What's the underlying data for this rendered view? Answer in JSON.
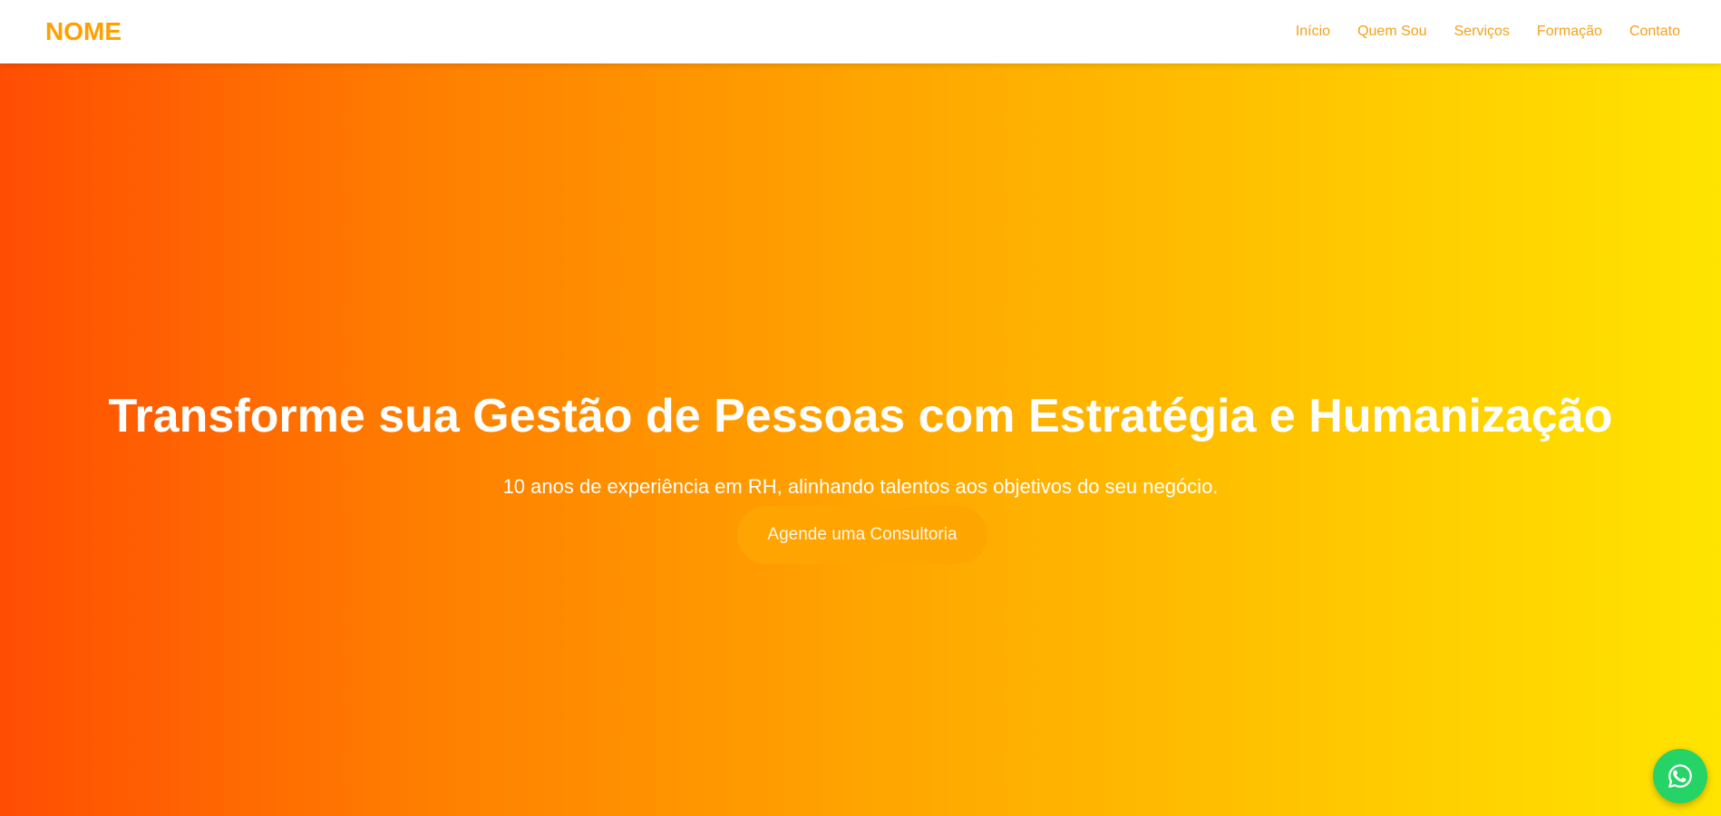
{
  "header": {
    "logo": "NOME",
    "nav": [
      {
        "label": "Início"
      },
      {
        "label": "Quem Sou"
      },
      {
        "label": "Serviços"
      },
      {
        "label": "Formação"
      },
      {
        "label": "Contato"
      }
    ]
  },
  "hero": {
    "title": "Transforme sua Gestão de Pessoas com Estratégia e Humanização",
    "subtitle": "10 anos de experiência em RH, alinhando talentos aos objetivos do seu negócio.",
    "cta_label": "Agende uma Consultoria"
  },
  "floating": {
    "icon": "whatsapp-icon"
  },
  "colors": {
    "brand": "#FFA000",
    "nav_link": "#F4A11A",
    "gradient_start": "#FF4E03",
    "gradient_end": "#FFE400",
    "cta_bg": "#FFA500",
    "whatsapp": "#25D366"
  }
}
